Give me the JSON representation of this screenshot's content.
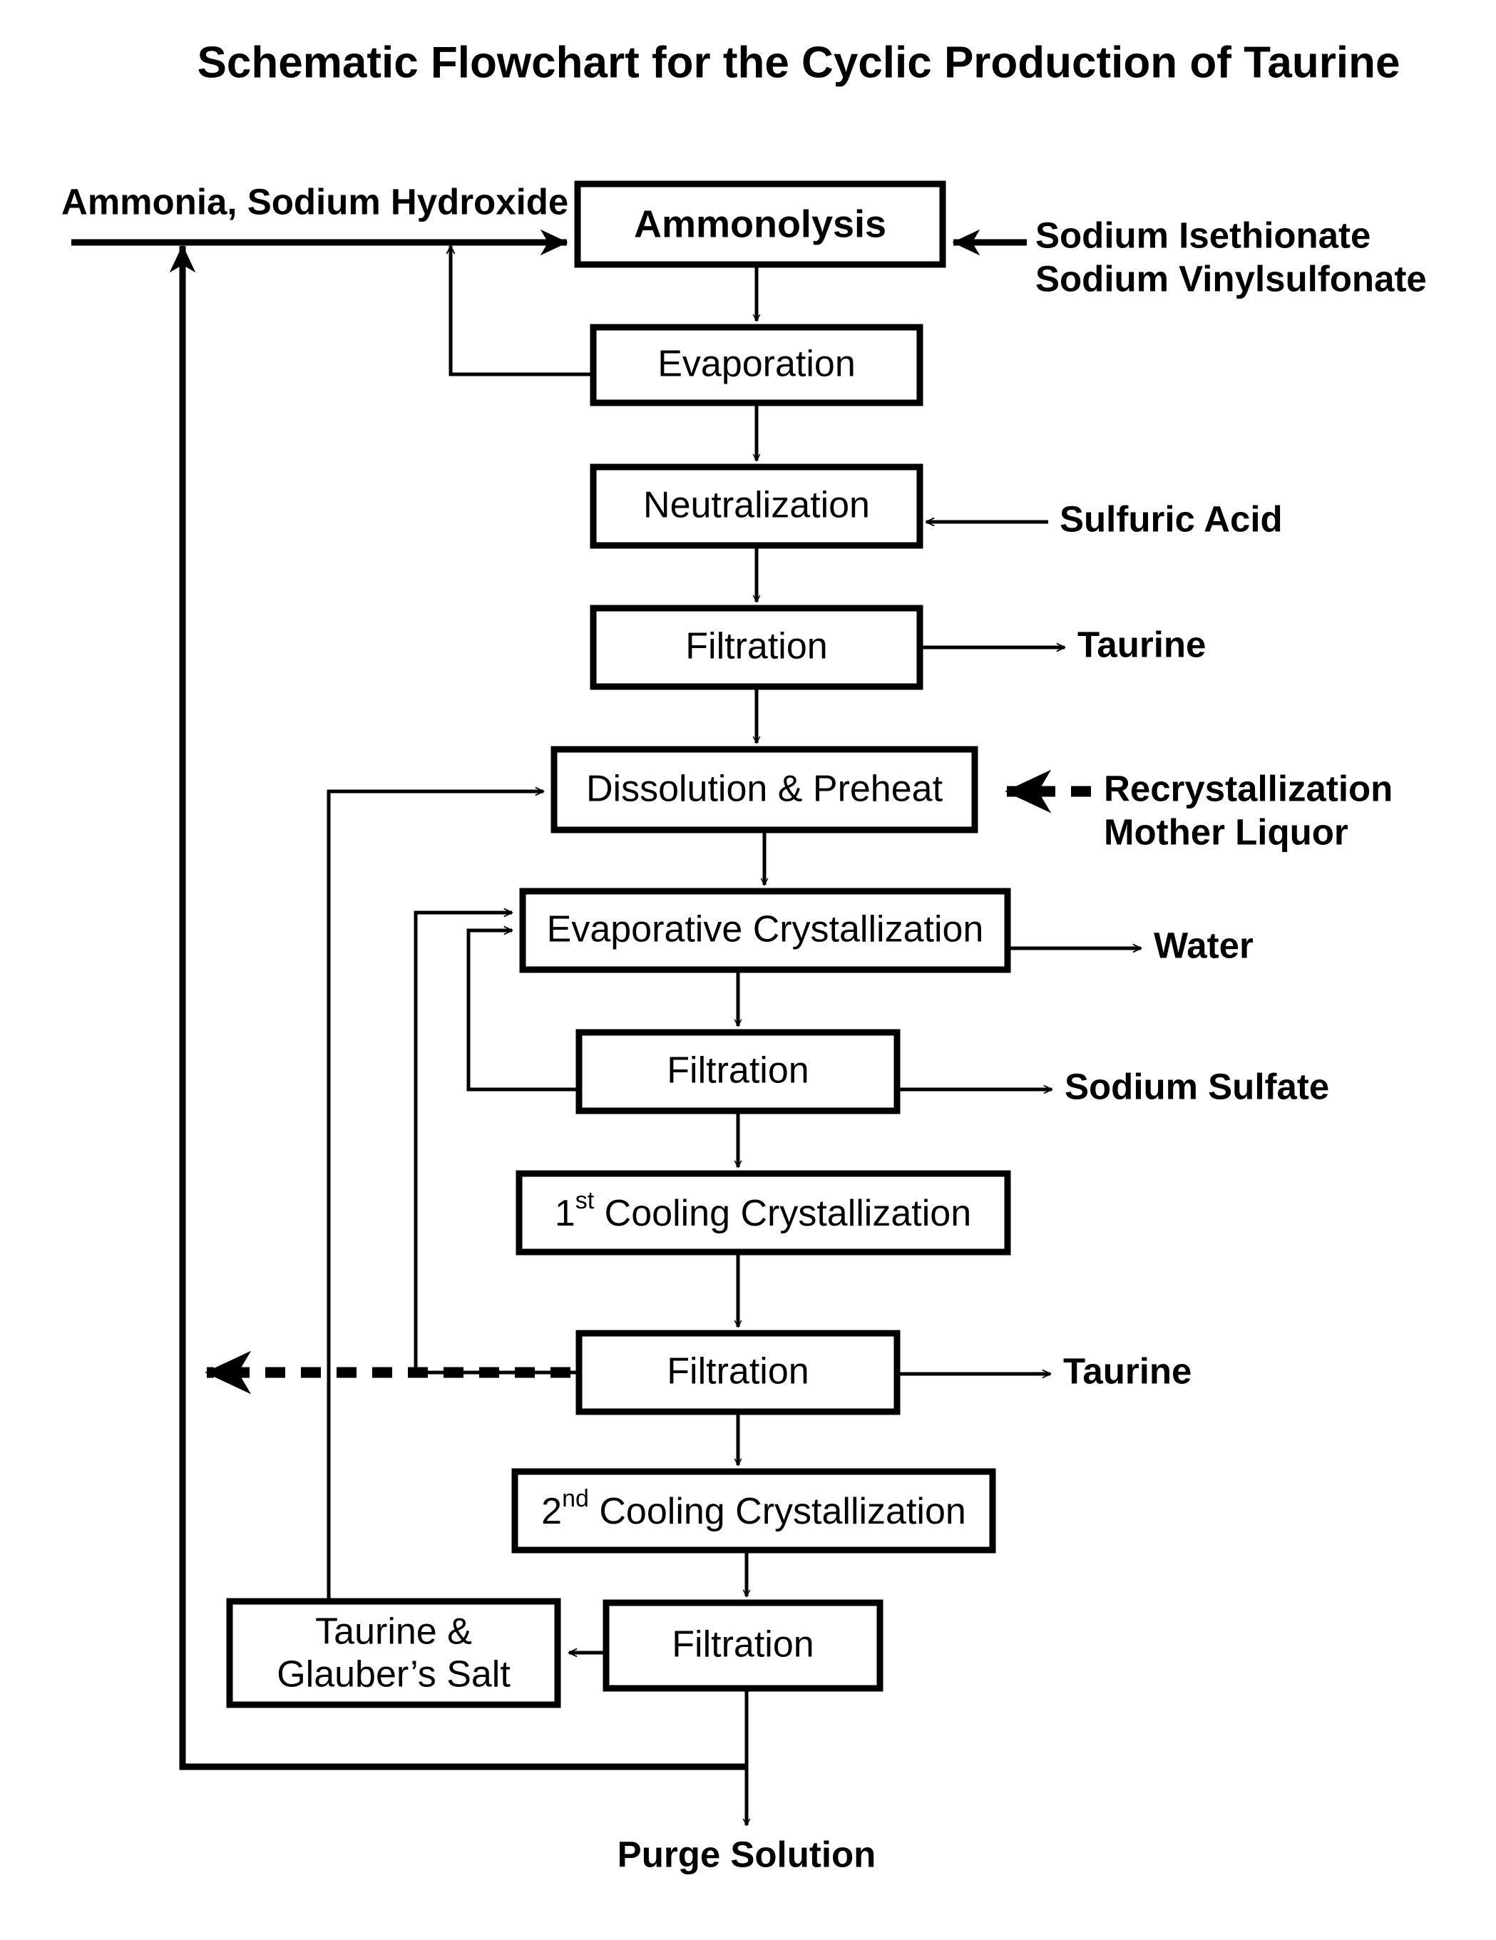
{
  "title": "Schematic Flowchart for the Cyclic Production of Taurine",
  "colors": {
    "line": "#000000",
    "box_fill": "#ffffff",
    "text": "#000000",
    "background": "#ffffff"
  },
  "chart_data": {
    "type": "diagram",
    "diagram_kind": "process-flowchart",
    "title": "Schematic Flowchart for the Cyclic Production of Taurine",
    "nodes": [
      {
        "id": "ammonolysis",
        "label": "Ammonolysis",
        "bold": true
      },
      {
        "id": "evaporation",
        "label": "Evaporation",
        "bold": false
      },
      {
        "id": "neutralization",
        "label": "Neutralization",
        "bold": false
      },
      {
        "id": "filtration1",
        "label": "Filtration",
        "bold": false
      },
      {
        "id": "dissolution",
        "label": "Dissolution & Preheat",
        "bold": false
      },
      {
        "id": "evap_cryst",
        "label": "Evaporative Crystallization",
        "bold": false
      },
      {
        "id": "filtration2",
        "label": "Filtration",
        "bold": false
      },
      {
        "id": "cool_cryst_1",
        "label": "1st Cooling Crystallization",
        "label_base": "1",
        "label_sup": "st",
        "label_rest": " Cooling Crystallization",
        "bold": false
      },
      {
        "id": "filtration3",
        "label": "Filtration",
        "bold": false
      },
      {
        "id": "cool_cryst_2",
        "label": "2nd Cooling Crystallization",
        "label_base": "2",
        "label_sup": "nd",
        "label_rest": " Cooling Crystallization",
        "bold": false
      },
      {
        "id": "filtration4",
        "label": "Filtration",
        "bold": false
      },
      {
        "id": "taurine_glauber",
        "label_line1": "Taurine &",
        "label_line2": "Glauber’s Salt",
        "bold": false
      }
    ],
    "stream_labels": [
      {
        "id": "feed_ammonia",
        "text": "Ammonia, Sodium Hydroxide",
        "side": "left-top"
      },
      {
        "id": "feed_isethionate",
        "text": "Sodium Isethionate",
        "side": "right"
      },
      {
        "id": "feed_vinylsulfonate",
        "text": "Sodium Vinylsulfonate",
        "side": "right"
      },
      {
        "id": "feed_sulfuric_acid",
        "text": "Sulfuric Acid",
        "side": "right"
      },
      {
        "id": "product_taurine_1",
        "text": "Taurine",
        "side": "right"
      },
      {
        "id": "recycle_mother_liquor_line1",
        "text": "Recrystallization",
        "side": "right"
      },
      {
        "id": "recycle_mother_liquor_line2",
        "text": "Mother Liquor",
        "side": "right"
      },
      {
        "id": "product_water",
        "text": "Water",
        "side": "right"
      },
      {
        "id": "product_sodium_sulfate",
        "text": "Sodium Sulfate",
        "side": "right"
      },
      {
        "id": "product_taurine_2",
        "text": "Taurine",
        "side": "right"
      },
      {
        "id": "product_purge",
        "text": "Purge Solution",
        "side": "bottom"
      }
    ],
    "edges": [
      {
        "from": "feed_ammonia",
        "to": "ammonolysis",
        "style": "solid"
      },
      {
        "from": "feed_isethionate_vinylsulfonate",
        "to": "ammonolysis",
        "style": "solid"
      },
      {
        "from": "ammonolysis",
        "to": "evaporation",
        "style": "solid"
      },
      {
        "from": "evaporation",
        "to": "feed_line_ammonia",
        "style": "solid",
        "note": "ammonia recycle"
      },
      {
        "from": "evaporation",
        "to": "neutralization",
        "style": "solid"
      },
      {
        "from": "feed_sulfuric_acid",
        "to": "neutralization",
        "style": "solid"
      },
      {
        "from": "neutralization",
        "to": "filtration1",
        "style": "solid"
      },
      {
        "from": "filtration1",
        "to": "product_taurine_1",
        "style": "solid"
      },
      {
        "from": "filtration1",
        "to": "dissolution",
        "style": "solid"
      },
      {
        "from": "recycle_mother_liquor",
        "to": "dissolution",
        "style": "dashed"
      },
      {
        "from": "dissolution",
        "to": "evap_cryst",
        "style": "solid"
      },
      {
        "from": "evap_cryst",
        "to": "product_water",
        "style": "solid"
      },
      {
        "from": "evap_cryst",
        "to": "filtration2",
        "style": "solid"
      },
      {
        "from": "filtration2",
        "to": "product_sodium_sulfate",
        "style": "solid"
      },
      {
        "from": "filtration2",
        "to": "evap_cryst",
        "style": "solid",
        "note": "recycle"
      },
      {
        "from": "filtration2",
        "to": "cool_cryst_1",
        "style": "solid"
      },
      {
        "from": "cool_cryst_1",
        "to": "filtration3",
        "style": "solid"
      },
      {
        "from": "filtration3",
        "to": "product_taurine_2",
        "style": "solid"
      },
      {
        "from": "filtration3",
        "to": "evap_cryst",
        "style": "solid",
        "note": "recycle"
      },
      {
        "from": "filtration3",
        "to": "recycle_mother_liquor_return",
        "style": "dashed"
      },
      {
        "from": "filtration3",
        "to": "cool_cryst_2",
        "style": "solid"
      },
      {
        "from": "cool_cryst_2",
        "to": "filtration4",
        "style": "solid"
      },
      {
        "from": "filtration4",
        "to": "taurine_glauber",
        "style": "solid"
      },
      {
        "from": "taurine_glauber",
        "to": "dissolution",
        "style": "solid",
        "note": "recycle"
      },
      {
        "from": "filtration4",
        "to": "product_purge",
        "style": "solid"
      },
      {
        "from": "purge_line",
        "to": "feed_line_ammonia",
        "style": "solid",
        "note": "recycle loop"
      }
    ]
  },
  "boxes": {
    "ammonolysis": "Ammonolysis",
    "evaporation": "Evaporation",
    "neutralization": "Neutralization",
    "filtration1": "Filtration",
    "dissolution": "Dissolution & Preheat",
    "evap_cryst": "Evaporative Crystallization",
    "filtration2": "Filtration",
    "cool_cryst_1_num": "1",
    "cool_cryst_1_sup": "st",
    "cool_cryst_1_rest": " Cooling Crystallization",
    "filtration3": "Filtration",
    "cool_cryst_2_num": "2",
    "cool_cryst_2_sup": "nd",
    "cool_cryst_2_rest": " Cooling Crystallization",
    "filtration4": "Filtration",
    "taurine_glauber_line1": "Taurine &",
    "taurine_glauber_line2": "Glauber’s Salt"
  },
  "streams": {
    "ammonia_naoh": "Ammonia, Sodium Hydroxide",
    "sodium_isethionate": "Sodium Isethionate",
    "sodium_vinylsulfonate": "Sodium Vinylsulfonate",
    "sulfuric_acid": "Sulfuric Acid",
    "taurine_1": "Taurine",
    "recryst_line1": "Recrystallization",
    "recryst_line2": "Mother Liquor",
    "water": "Water",
    "sodium_sulfate": "Sodium Sulfate",
    "taurine_2": "Taurine",
    "purge_solution": "Purge Solution"
  }
}
